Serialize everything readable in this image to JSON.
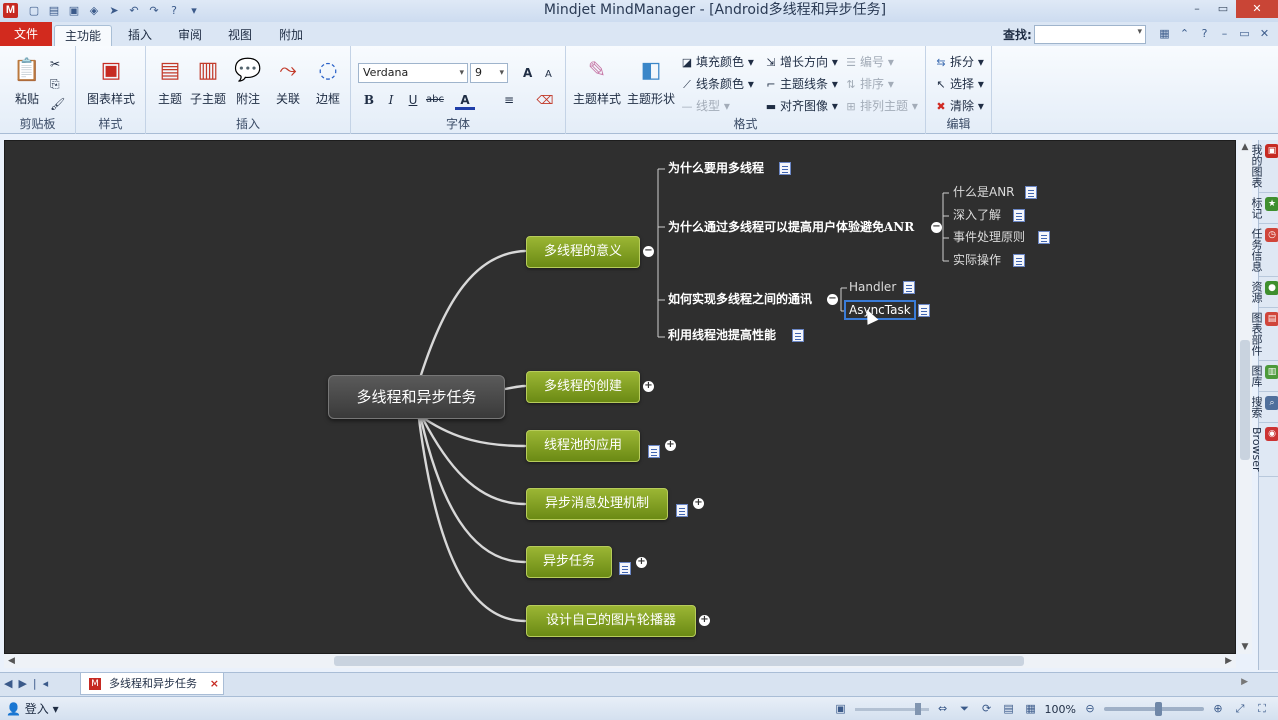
{
  "window": {
    "app_logo": "M",
    "title": "Mindjet MindManager - [Android多线程和异步任务]",
    "controls": [
      "–",
      "▭",
      "✕"
    ]
  },
  "ribbon_tabs": {
    "file": "文件",
    "tabs": [
      "主功能",
      "插入",
      "审阅",
      "视图",
      "附加"
    ],
    "active_index": 0,
    "find_label": "查找:"
  },
  "ribbon": {
    "clipboard": {
      "title": "剪贴板",
      "paste": "粘贴"
    },
    "style": {
      "title": "样式",
      "chart_style": "图表样式"
    },
    "insert": {
      "title": "插入",
      "topic": "主题",
      "subtopic": "子主题",
      "callout": "附注",
      "relationship": "关联",
      "boundary": "边框"
    },
    "font": {
      "title": "字体",
      "family": "Verdana",
      "size": "9",
      "grow": "A",
      "shrink": "A",
      "bold": "B",
      "italic": "I",
      "underline": "U",
      "strike": "abc",
      "color": "A"
    },
    "format": {
      "title": "格式",
      "topic_style": "主题样式",
      "topic_shape": "主题形状",
      "fill_color": "填充颜色",
      "line_color": "线条颜色",
      "line_shape": "线型",
      "growth": "增长方向",
      "topic_lines": "主题线条",
      "align_image": "对齐图像",
      "numbering": "编号",
      "sort": "排序",
      "arrange": "排列主题"
    },
    "edit": {
      "title": "编辑",
      "split": "拆分",
      "select": "选择",
      "clear": "清除"
    }
  },
  "mindmap": {
    "central": "多线程和异步任务",
    "main_topics": [
      {
        "label": "多线程的意义",
        "expanded": true
      },
      {
        "label": "多线程的创建",
        "expanded": false
      },
      {
        "label": "线程池的应用",
        "expanded": false
      },
      {
        "label": "异步消息处理机制",
        "expanded": false
      },
      {
        "label": "异步任务",
        "expanded": false
      },
      {
        "label": "设计自己的图片轮播器",
        "expanded": false
      }
    ],
    "subtopics": [
      "为什么要用多线程",
      "为什么通过多线程可以提高用户体验避免ANR",
      "如何实现多线程之间的通讯",
      "利用线程池提高性能"
    ],
    "anr_children": [
      "什么是ANR",
      "深入了解",
      "事件处理原则",
      "实际操作"
    ],
    "comm_children": [
      "Handler",
      "AsyncTask"
    ],
    "selected": "AsyncTask"
  },
  "side_panel": {
    "items": [
      {
        "label": "我的图表",
        "color": "#c62a22"
      },
      {
        "label": "标记",
        "color": "#3f8f2e"
      },
      {
        "label": "任务信息",
        "color": "#d0453a"
      },
      {
        "label": "资源",
        "color": "#3f8f2e"
      },
      {
        "label": "图表部件",
        "color": "#d0453a"
      },
      {
        "label": "图库",
        "color": "#4d9a3a"
      },
      {
        "label": "搜索",
        "color": "#4f6f9c"
      },
      {
        "label": "Browser",
        "color": "#c33"
      }
    ]
  },
  "doc_tabs": {
    "active": "多线程和异步任务"
  },
  "status": {
    "login": "登入",
    "zoom": "100%",
    "zoom_fraction": 0.55
  },
  "colors": {
    "canvas_bg": "#2f2f2f",
    "main_topic_fill": "#7f9e1e",
    "file_tab": "#d22a1e",
    "selection": "#3a7cd8"
  }
}
